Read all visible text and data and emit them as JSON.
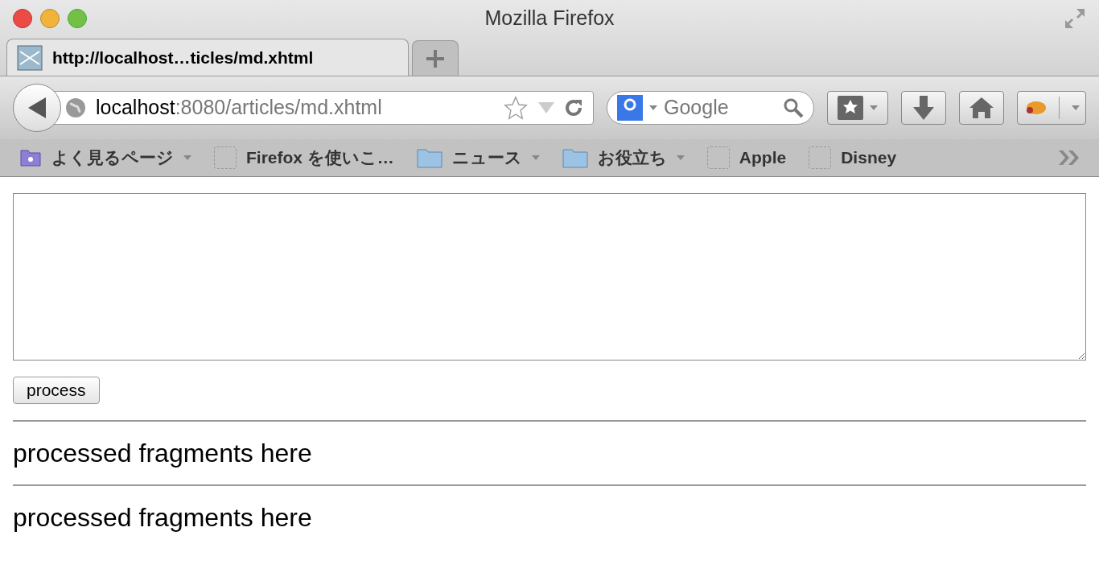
{
  "window": {
    "title": "Mozilla Firefox"
  },
  "tabs": [
    {
      "label": "http://localhost…ticles/md.xhtml",
      "selected": true
    }
  ],
  "address": {
    "host": "localhost",
    "path": ":8080/articles/md.xhtml"
  },
  "search": {
    "placeholder": "Google"
  },
  "bookmarks": [
    {
      "kind": "smart",
      "label": "よく見るページ"
    },
    {
      "kind": "page",
      "label": "Firefox を使いこ…"
    },
    {
      "kind": "folder",
      "label": "ニュース"
    },
    {
      "kind": "folder",
      "label": "お役立ち"
    },
    {
      "kind": "page",
      "label": "Apple"
    },
    {
      "kind": "page",
      "label": "Disney"
    }
  ],
  "page": {
    "button": "process",
    "fragments": [
      "processed fragments here",
      "processed fragments here"
    ]
  }
}
